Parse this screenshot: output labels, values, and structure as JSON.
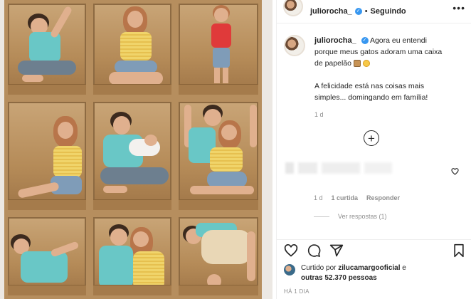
{
  "post": {
    "username": "juliorocha_",
    "dot": "•",
    "following_label": "Seguindo",
    "more_label": "•••"
  },
  "caption": {
    "username": "juliorocha_",
    "line1": "Agora eu entendi porque meus gatos adoram uma caixa de papelão",
    "line2": "A felicidade está nas coisas mais simples... domingando em família!",
    "age": "1 d"
  },
  "comment": {
    "age": "1 d",
    "likes": "1 curtida",
    "reply_label": "Responder",
    "view_replies": "Ver respostas (1)"
  },
  "likes": {
    "prefix": "Curtido por",
    "user": "zilucamargooficial",
    "connector": "e",
    "others": "outras 52.370 pessoas"
  },
  "timestamp": "HÁ 1 DIA",
  "icons": {
    "verified": "verified-badge-icon",
    "more": "more-options-icon",
    "load_more": "plus-circle-icon",
    "comment_like": "heart-icon",
    "like": "heart-icon",
    "comment": "comment-bubble-icon",
    "share": "paper-plane-icon",
    "save": "bookmark-icon"
  },
  "colors": {
    "verified_blue": "#3897f0",
    "text": "#262626",
    "muted": "#8e8e8e",
    "cardboard": "#b68e5e"
  }
}
